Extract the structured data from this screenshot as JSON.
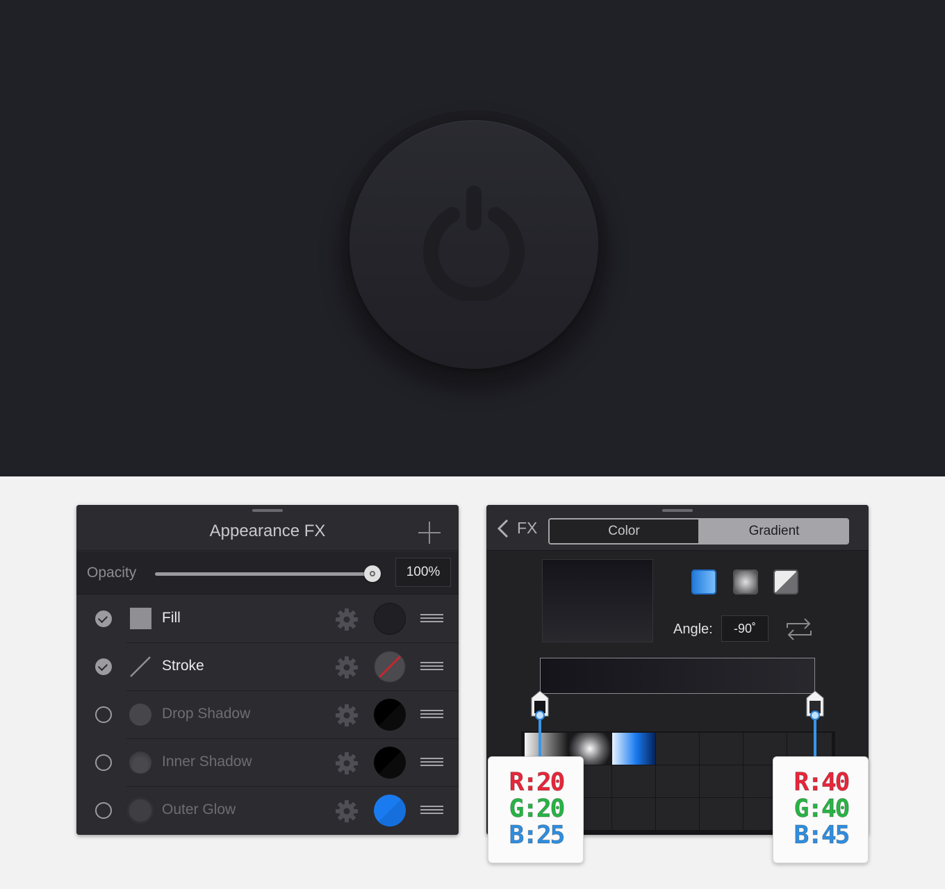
{
  "fx_panel": {
    "title": "Appearance FX",
    "opacity_label": "Opacity",
    "opacity_value": "100%",
    "opacity_level": 1.0,
    "rows": [
      {
        "label": "Fill",
        "enabled": true,
        "swatch_color": "#1f1f24",
        "icon": "square-fill-icon"
      },
      {
        "label": "Stroke",
        "enabled": true,
        "swatch_color": "none",
        "icon": "stroke-line-icon"
      },
      {
        "label": "Drop Shadow",
        "enabled": false,
        "swatch_color": "#000000",
        "icon": "drop-shadow-icon"
      },
      {
        "label": "Inner Shadow",
        "enabled": false,
        "swatch_color": "#000000",
        "icon": "inner-shadow-icon"
      },
      {
        "label": "Outer Glow",
        "enabled": false,
        "swatch_color": "#1a7bf0",
        "icon": "outer-glow-icon"
      }
    ]
  },
  "gradient_panel": {
    "back_label": "FX",
    "tabs": [
      "Color",
      "Gradient"
    ],
    "active_tab": "Gradient",
    "angle_label": "Angle:",
    "angle_value": "-90˚",
    "gradient_types": [
      "linear",
      "radial",
      "conical"
    ],
    "stops": [
      {
        "r": "R:20",
        "g": "G:20",
        "b": "B:25",
        "color": "#141419"
      },
      {
        "r": "R:40",
        "g": "G:40",
        "b": "B:45",
        "color": "#28282d"
      }
    ]
  }
}
